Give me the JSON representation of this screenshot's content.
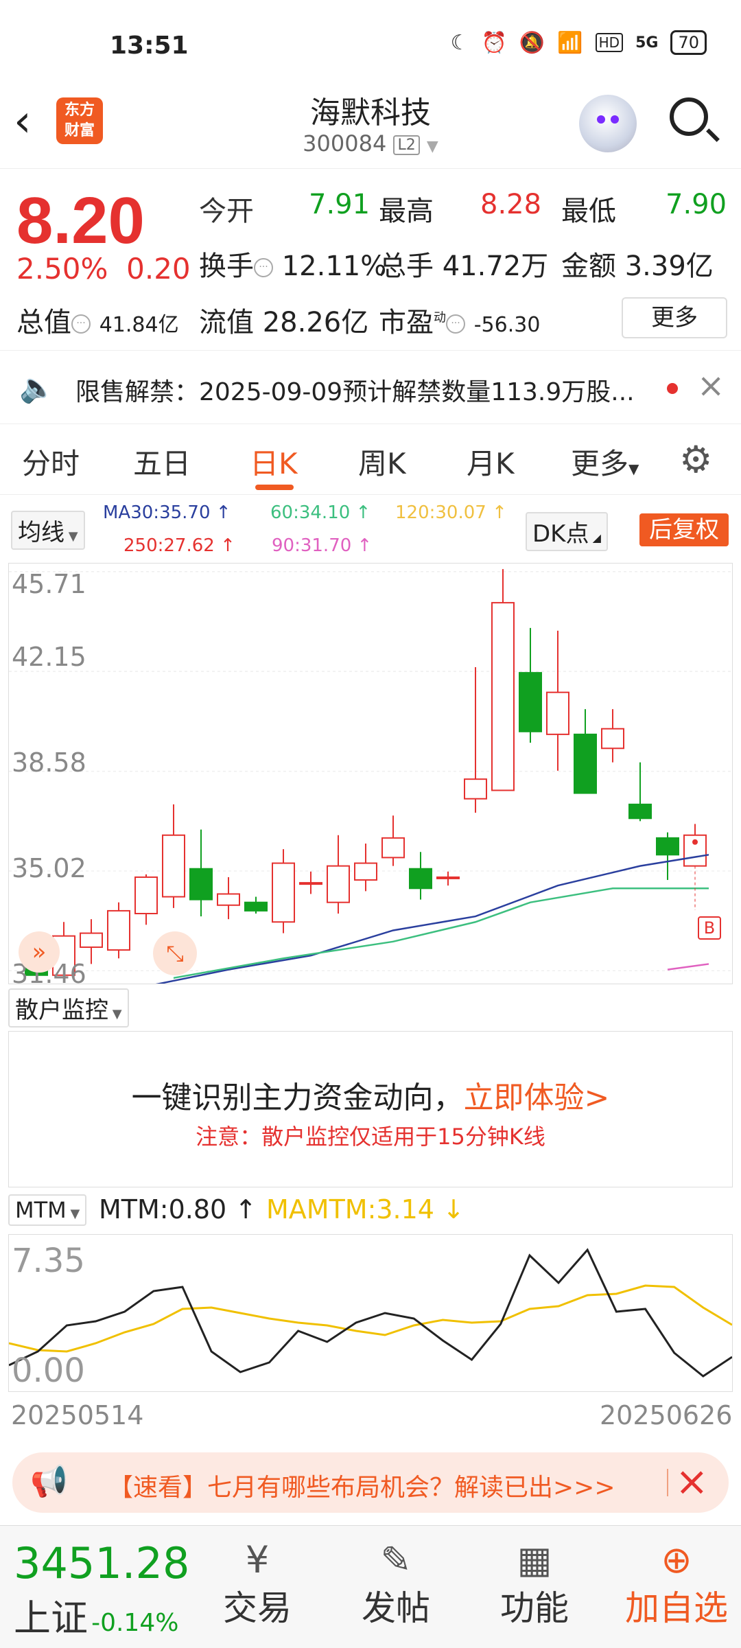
{
  "status_bar": {
    "time": "13:51",
    "battery": "70",
    "net": "5G",
    "hd": "HD"
  },
  "header": {
    "title": "海默科技",
    "code": "300084",
    "badge": "L2",
    "logo_line1": "东方",
    "logo_line2": "财富"
  },
  "quote": {
    "price": "8.20",
    "change_pct": "2.50%",
    "change": "0.20",
    "open_label": "今开",
    "open": "7.91",
    "high_label": "最高",
    "high": "8.28",
    "low_label": "最低",
    "low": "7.90",
    "turnover_label": "换手",
    "turnover": "12.11%",
    "volume_label": "总手",
    "volume": "41.72万",
    "amount_label": "金额",
    "amount": "3.39亿",
    "mktcap_label": "总值",
    "mktcap": "41.84亿",
    "float_label": "流值",
    "float_cap": "28.26亿",
    "pe_label": "市盈",
    "pe_sup": "动",
    "pe": "-56.30",
    "more_label": "更多"
  },
  "notice": {
    "text": "限售解禁：2025-09-09预计解禁数量113.9万股..."
  },
  "tabs": [
    "分时",
    "五日",
    "日K",
    "周K",
    "月K",
    "更多"
  ],
  "active_tab": "日K",
  "kline": {
    "indicator_select": "均线",
    "ma": [
      {
        "label": "MA30:35.70",
        "arrow": "↑",
        "color": "#2a3f9e"
      },
      {
        "label": "60:34.10",
        "arrow": "↑",
        "color": "#3cbf7f"
      },
      {
        "label": "120:30.07",
        "arrow": "↑",
        "color": "#f0c040"
      },
      {
        "label": "250:27.62",
        "arrow": "↑",
        "color": "#e5312f"
      },
      {
        "label": "90:31.70",
        "arrow": "↑",
        "color": "#e060c0"
      }
    ],
    "dk_label": "DK点",
    "fuquan_label": "后复权",
    "y_ticks": [
      "45.71",
      "42.15",
      "38.58",
      "35.02",
      "31.46"
    ],
    "b_marker": "B"
  },
  "chart_data": {
    "type": "candlestick",
    "y_ticks": [
      45.71,
      42.15,
      38.58,
      35.02,
      31.46
    ],
    "candles": [
      {
        "o": 31.6,
        "c": 31.3,
        "h": 32.0,
        "l": 31.2
      },
      {
        "o": 31.3,
        "c": 32.7,
        "h": 33.2,
        "l": 31.2
      },
      {
        "o": 32.3,
        "c": 32.8,
        "h": 33.3,
        "l": 31.7
      },
      {
        "o": 32.2,
        "c": 33.6,
        "h": 33.9,
        "l": 31.9
      },
      {
        "o": 33.5,
        "c": 34.8,
        "h": 34.9,
        "l": 33.1
      },
      {
        "o": 34.1,
        "c": 36.3,
        "h": 37.4,
        "l": 33.7
      },
      {
        "o": 35.1,
        "c": 34.0,
        "h": 36.5,
        "l": 33.4
      },
      {
        "o": 33.8,
        "c": 34.2,
        "h": 34.8,
        "l": 33.3
      },
      {
        "o": 33.9,
        "c": 33.6,
        "h": 34.1,
        "l": 33.5
      },
      {
        "o": 33.2,
        "c": 35.3,
        "h": 35.8,
        "l": 32.8
      },
      {
        "o": 34.6,
        "c": 34.6,
        "h": 35.0,
        "l": 34.2
      },
      {
        "o": 33.9,
        "c": 35.2,
        "h": 36.3,
        "l": 33.5
      },
      {
        "o": 34.7,
        "c": 35.3,
        "h": 36.0,
        "l": 34.3
      },
      {
        "o": 35.5,
        "c": 36.2,
        "h": 37.0,
        "l": 35.2
      },
      {
        "o": 35.1,
        "c": 34.4,
        "h": 35.7,
        "l": 34.0
      },
      {
        "o": 34.8,
        "c": 34.8,
        "h": 35.0,
        "l": 34.5
      },
      {
        "o": 37.6,
        "c": 38.3,
        "h": 42.3,
        "l": 37.1
      },
      {
        "o": 37.9,
        "c": 44.6,
        "h": 45.8,
        "l": 37.9
      },
      {
        "o": 42.1,
        "c": 40.0,
        "h": 43.7,
        "l": 39.6
      },
      {
        "o": 39.9,
        "c": 41.4,
        "h": 43.6,
        "l": 38.6
      },
      {
        "o": 39.9,
        "c": 37.8,
        "h": 40.8,
        "l": 37.8
      },
      {
        "o": 39.4,
        "c": 40.1,
        "h": 40.8,
        "l": 38.9
      },
      {
        "o": 37.4,
        "c": 36.9,
        "h": 38.9,
        "l": 36.8
      },
      {
        "o": 36.2,
        "c": 35.6,
        "h": 36.4,
        "l": 34.7
      },
      {
        "o": 35.2,
        "c": 36.3,
        "h": 36.7,
        "l": 35.2
      }
    ],
    "ma_lines": [
      {
        "name": "MA30",
        "color": "#2a3f9e",
        "points": [
          [
            4,
            30.9
          ],
          [
            7,
            31.5
          ],
          [
            10,
            32.0
          ],
          [
            13,
            32.9
          ],
          [
            16,
            33.4
          ],
          [
            19,
            34.5
          ],
          [
            22,
            35.2
          ],
          [
            24.5,
            35.6
          ]
        ]
      },
      {
        "name": "60",
        "color": "#3cbf7f",
        "points": [
          [
            5,
            31.2
          ],
          [
            9,
            31.9
          ],
          [
            13,
            32.5
          ],
          [
            16,
            33.2
          ],
          [
            18,
            33.9
          ],
          [
            21,
            34.4
          ],
          [
            24.5,
            34.4
          ]
        ]
      },
      {
        "name": "90",
        "color": "#e060c0",
        "points": [
          [
            23,
            31.5
          ],
          [
            24.5,
            31.7
          ]
        ]
      }
    ],
    "mtm": {
      "label": "MTM",
      "value_label": "MTM:0.80",
      "value_arrow": "↑",
      "ma_label": "MAMTM:3.14",
      "ma_arrow": "↓",
      "y_ticks": [
        "7.35",
        "0.00"
      ],
      "x_start": "20250514",
      "x_end": "20250626",
      "mtm": [
        0.2,
        1.2,
        3.1,
        3.4,
        4.1,
        5.6,
        5.9,
        1.2,
        -0.3,
        0.4,
        2.7,
        1.9,
        3.3,
        4.0,
        3.6,
        2.0,
        0.6,
        3.2,
        8.2,
        6.2,
        8.6,
        4.1,
        4.3,
        1.1,
        -0.6,
        0.8
      ],
      "mamtm": [
        1.8,
        1.3,
        1.2,
        1.8,
        2.6,
        3.2,
        4.3,
        4.4,
        4.0,
        3.6,
        3.3,
        3.1,
        2.7,
        2.4,
        3.1,
        3.5,
        3.3,
        3.4,
        4.3,
        4.5,
        5.3,
        5.4,
        6.0,
        5.9,
        4.4,
        3.14
      ]
    }
  },
  "sanhu": {
    "select": "散户监控",
    "main_text": "一键识别主力资金动向，",
    "link": "立即体验>",
    "note": "注意：散户监控仅适用于15分钟K线"
  },
  "mtm_panel": {
    "select": "MTM"
  },
  "banner": {
    "text": "【速看】七月有哪些布局机会？解读已出>>>"
  },
  "bottom": {
    "index_value": "3451.28",
    "index_name": "上证",
    "index_change": "-0.14%",
    "items": [
      "交易",
      "发帖",
      "功能",
      "加自选"
    ]
  },
  "colors": {
    "accent": "#f05a22",
    "up": "#e5312f",
    "down": "#10a020"
  }
}
